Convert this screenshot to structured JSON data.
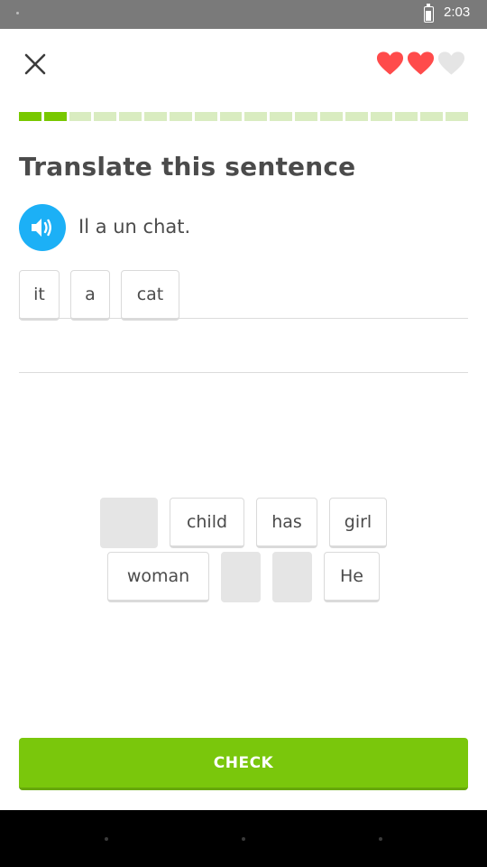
{
  "status_bar": {
    "time": "2:03"
  },
  "hearts": {
    "filled": 2,
    "total": 3,
    "filled_color": "#ff4b4b",
    "empty_color": "#e5e5e5"
  },
  "progress": {
    "completed_segments": 2,
    "total_segments": 18,
    "done_color": "#78c800",
    "todo_color": "#d9ecc0"
  },
  "exercise": {
    "instruction": "Translate this sentence",
    "prompt": "Il a un chat."
  },
  "answer_tiles": [
    "it",
    "a",
    "cat"
  ],
  "word_bank": {
    "row1": [
      {
        "label": "",
        "used": true
      },
      {
        "label": "child",
        "used": false
      },
      {
        "label": "has",
        "used": false
      },
      {
        "label": "girl",
        "used": false
      }
    ],
    "row2": [
      {
        "label": "woman",
        "used": false
      },
      {
        "label": "",
        "used": true
      },
      {
        "label": "",
        "used": true
      },
      {
        "label": "He",
        "used": false
      }
    ]
  },
  "check_button": {
    "label": "CHECK",
    "color": "#7ac70c"
  }
}
